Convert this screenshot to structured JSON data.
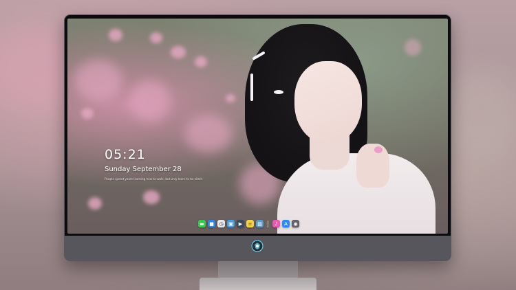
{
  "lockscreen": {
    "time": "05:21",
    "date": "Sunday September  28",
    "caption": "People spend years learning how to walk, but only learn to be silent"
  },
  "dock": {
    "icons": [
      {
        "name": "messages-icon",
        "color": "#3cc750",
        "glyph": "▬"
      },
      {
        "name": "files-icon",
        "color": "#2e86e6",
        "glyph": "■"
      },
      {
        "name": "clock-icon",
        "color": "#e8e8ea",
        "glyph": "◷"
      },
      {
        "name": "photos-icon",
        "color": "#4aa0e0",
        "glyph": "▣"
      },
      {
        "name": "video-icon",
        "color": "#3b4b5a",
        "glyph": "▶"
      },
      {
        "name": "notes-icon",
        "color": "#f4d34c",
        "glyph": "≡"
      },
      {
        "name": "gallery-icon",
        "color": "#5a9ec9",
        "glyph": "▨"
      },
      {
        "name": "music-icon",
        "color": "#e75ab0",
        "glyph": "♪"
      },
      {
        "name": "app-store-icon",
        "color": "#2d8bf0",
        "glyph": "A"
      },
      {
        "name": "camera-icon",
        "color": "#606066",
        "glyph": "◉"
      }
    ]
  },
  "colors": {
    "monitor_frame": "#57565c",
    "bezel": "#0c0c0e",
    "accent_badge": "#5fc9e8"
  }
}
